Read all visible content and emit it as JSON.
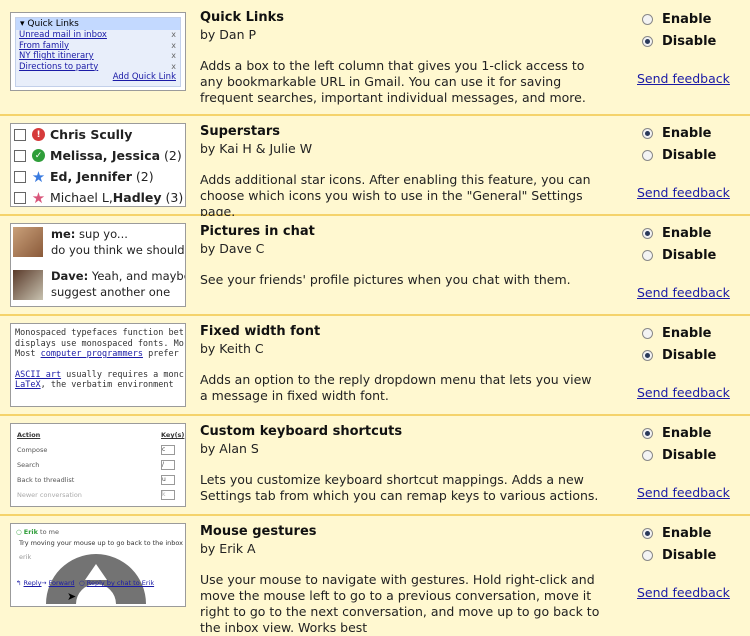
{
  "features": [
    {
      "title": "Quick Links",
      "author": "by Dan P",
      "description": "Adds a box to the left column that gives you 1-click access to any bookmarkable URL in Gmail. You can use it for saving frequent searches, important individual messages, and more.",
      "enable": "Enable",
      "disable": "Disable",
      "selected": "disable",
      "feedback": "Send feedback",
      "thumb": {
        "header": "Quick Links",
        "links": [
          "Unread mail in inbox",
          "From family",
          "NY flight itinerary",
          "Directions to party"
        ],
        "remove": "x",
        "add": "Add Quick Link"
      }
    },
    {
      "title": "Superstars",
      "author": "by Kai H & Julie W",
      "description": "Adds additional star icons. After enabling this feature, you can choose which icons you wish to use in the \"General\" Settings page.",
      "enable": "Enable",
      "disable": "Disable",
      "selected": "enable",
      "feedback": "Send feedback",
      "thumb": {
        "rows": [
          {
            "name_bold": "Chris Scully",
            "name": "",
            "count": ""
          },
          {
            "name_bold": "Melissa, Jessica",
            "name": "",
            "count": "(2)"
          },
          {
            "name_bold": "Ed, Jennifer",
            "name": "",
            "count": "(2)"
          },
          {
            "name_bold": "Hadley",
            "name": "Michael L, ",
            "count": "(3)"
          }
        ]
      }
    },
    {
      "title": "Pictures in chat",
      "author": "by Dave C",
      "description": "See your friends' profile pictures when you chat with them.",
      "enable": "Enable",
      "disable": "Disable",
      "selected": "enable",
      "feedback": "Send feedback",
      "thumb": {
        "msg1_from": "me:",
        "msg1_a": " sup yo...",
        "msg1_b": "do you think we should",
        "msg2_from": "Dave:",
        "msg2_a": " Yeah, and maybe",
        "msg2_b": "suggest another one"
      }
    },
    {
      "title": "Fixed width font",
      "author": "by Keith C",
      "description": "Adds an option to the reply dropdown menu that lets you view a message in fixed width font.",
      "enable": "Enable",
      "disable": "Disable",
      "selected": "disable",
      "feedback": "Send feedback",
      "thumb": {
        "l1": "Monospaced typefaces function bet",
        "l2": "displays use monospaced fonts. Mo",
        "l3a": "Most ",
        "l3link": "computer programmers",
        "l3b": " prefer",
        "l4link": "ASCII art",
        "l4b": " usually requires a monc",
        "l5link": "LaTeX",
        "l5b": ", the verbatim environment"
      }
    },
    {
      "title": "Custom keyboard shortcuts",
      "author": "by Alan S",
      "description": "Lets you customize keyboard shortcut mappings. Adds a new Settings tab from which you can remap keys to various actions.",
      "enable": "Enable",
      "disable": "Disable",
      "selected": "enable",
      "feedback": "Send feedback",
      "thumb": {
        "col1": "Action",
        "col2": "Key(s)",
        "rows": [
          {
            "action": "Compose",
            "key": "c"
          },
          {
            "action": "Search",
            "key": "/"
          },
          {
            "action": "Back to threadlist",
            "key": "u"
          },
          {
            "action": "Newer conversation",
            "key": "k"
          }
        ]
      }
    },
    {
      "title": "Mouse gestures",
      "author": "by Erik A",
      "description": "Use your mouse to navigate with gestures. Hold right-click and move the mouse left to go to a previous conversation, move it right to go to the next conversation, and move up to go back to the inbox view. Works best",
      "enable": "Enable",
      "disable": "Disable",
      "selected": "enable",
      "feedback": "Send feedback",
      "thumb": {
        "from": "Erik",
        "to": "to me",
        "body": "Try moving your mouse up to go back to the inbox",
        "sig": "erik",
        "reply": "Reply",
        "forward": "Forward",
        "chat": "Reply by chat to Erik"
      }
    }
  ]
}
